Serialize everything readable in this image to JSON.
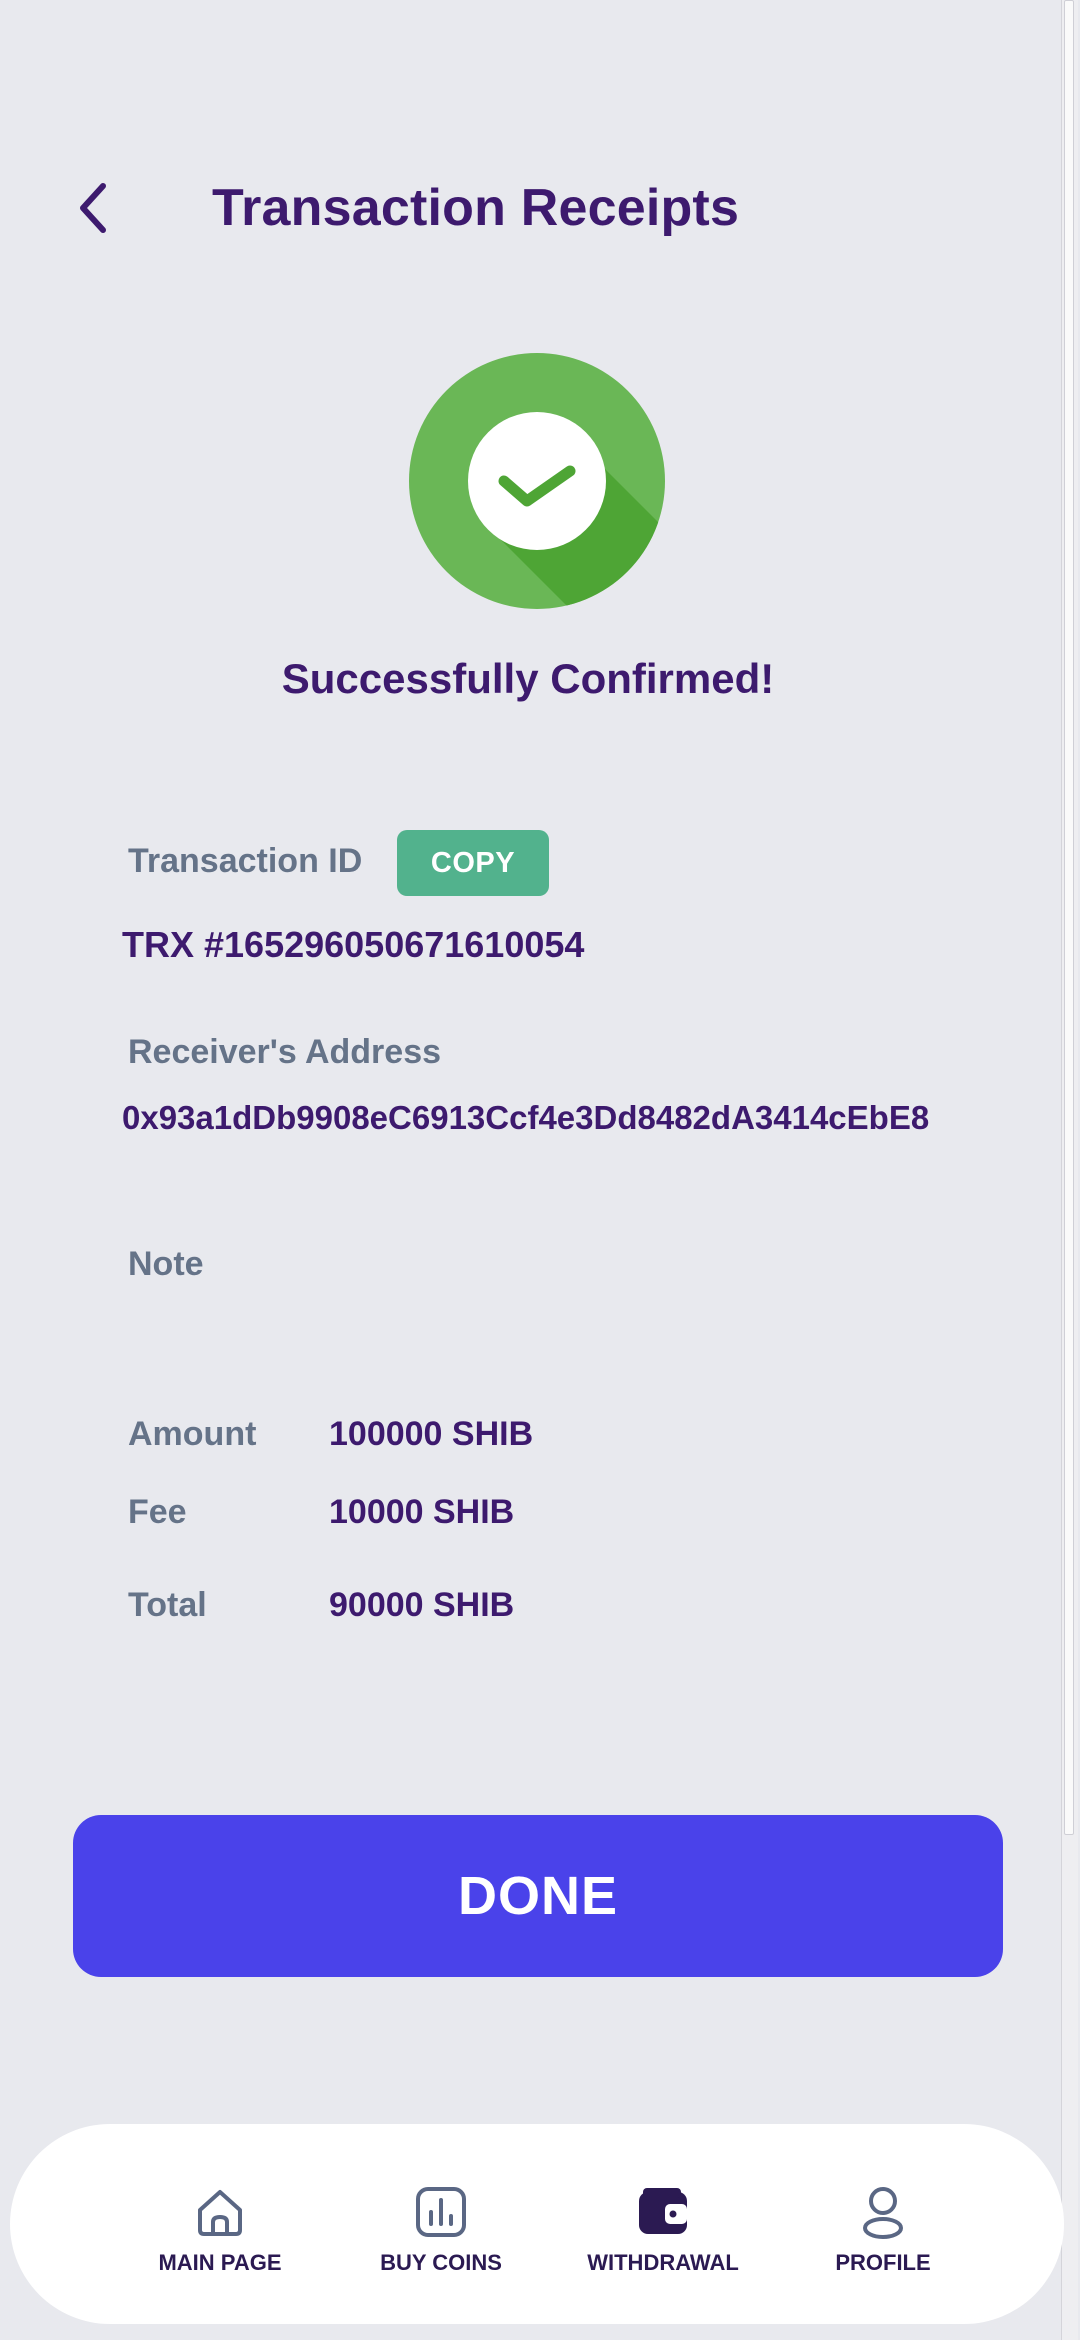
{
  "header": {
    "title": "Transaction Receipts",
    "back_icon": "chevron-left-icon"
  },
  "status": {
    "icon": "check-circle-icon",
    "message": "Successfully Confirmed!",
    "icon_color": "#6ab756"
  },
  "transaction": {
    "id_label": "Transaction ID",
    "copy_label": "COPY",
    "id_value": "TRX #165296050671610054",
    "address_label": "Receiver's Address",
    "address_value": "0x93a1dDb9908eC6913Ccf4e3Dd8482dA3414cEbE8",
    "note_label": "Note",
    "note_value": ""
  },
  "summary": {
    "amount_label": "Amount",
    "amount_value": "100000 SHIB",
    "fee_label": "Fee",
    "fee_value": "10000 SHIB",
    "total_label": "Total",
    "total_value": "90000 SHIB"
  },
  "actions": {
    "done_label": "DONE",
    "done_color": "#4a42ea"
  },
  "nav": {
    "active": "WITHDRAWAL",
    "items": [
      {
        "label": "MAIN PAGE",
        "icon": "home-icon"
      },
      {
        "label": "BUY COINS",
        "icon": "chart-icon"
      },
      {
        "label": "WITHDRAWAL",
        "icon": "wallet-icon"
      },
      {
        "label": "PROFILE",
        "icon": "user-icon"
      }
    ]
  },
  "colors": {
    "primary_text": "#3d1a6e",
    "label_text": "#657388",
    "copy_button": "#52b28d",
    "background": "#e8e9ee"
  }
}
